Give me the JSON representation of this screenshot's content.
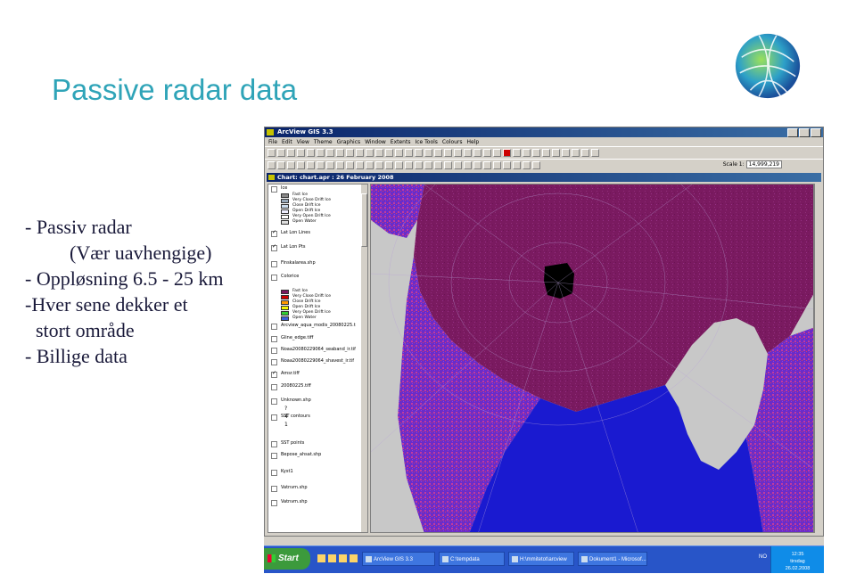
{
  "slide": {
    "title": "Passive radar data",
    "bullets": [
      "- Passiv radar",
      "(Vær uavhengige)",
      "- Oppløsning 6.5 - 25 km",
      "-Hver sene dekker et",
      "stort område",
      "- Billige data"
    ]
  },
  "app": {
    "title": "ArcView GIS 3.3",
    "menu": [
      "File",
      "Edit",
      "View",
      "Theme",
      "Graphics",
      "Window",
      "Extents",
      "Ice Tools",
      "Colours",
      "Help"
    ],
    "scale_label": "Scale 1:",
    "scale_value": "14,999,219",
    "view_title": "Chart: chart.apr : 26 February 2008"
  },
  "legend": {
    "layers": [
      {
        "name": "Ice",
        "checked": false
      },
      {
        "name": "Lat Lon Lines",
        "checked": true
      },
      {
        "name": "Lat Lon Pts",
        "checked": true
      },
      {
        "name": "Finskalarea.shp",
        "checked": false
      },
      {
        "name": "Colorice",
        "checked": false
      },
      {
        "name": "Arcview_aqua_modis_20080225.t",
        "checked": false
      },
      {
        "name": "Gline_edge.tiff",
        "checked": false
      },
      {
        "name": "Noaa20080229064_seaband_ir.tif",
        "checked": false
      },
      {
        "name": "Noaa20080229064_shavest_ir.tif",
        "checked": false
      },
      {
        "name": "Amsr.tiff",
        "checked": true
      },
      {
        "name": "20080225.tiff",
        "checked": false
      },
      {
        "name": "Unknown.shp",
        "checked": false
      },
      {
        "name": "SST contours",
        "checked": false
      },
      {
        "name": "SST points",
        "checked": false
      },
      {
        "name": "Bepose_ahsat.shp",
        "checked": false
      },
      {
        "name": "Kyst1",
        "checked": false
      },
      {
        "name": "Vatnvm.shp",
        "checked": false
      },
      {
        "name": "Vatnvm.shp",
        "checked": false
      }
    ],
    "ice_classes": [
      "Fast Ice",
      "Very Close Drift Ice",
      "Close Drift Ice",
      "Open Drift Ice",
      "Very Open Drift Ice",
      "Open Water"
    ],
    "colorice_classes": [
      "Fast Ice",
      "Very Close Drift Ice",
      "Close Drift Ice",
      "Open Drift Ice",
      "Very Open Drift Ice",
      "Open Water"
    ],
    "sst_labels": [
      "?",
      "4",
      "1"
    ]
  },
  "colors": {
    "title_teal": "#2fa4b8",
    "sea_ice": "#7a1a60",
    "ocean": "#1a1ad0",
    "land": "#c8c8c8",
    "title_bar": "#0a246a"
  },
  "taskbar": {
    "start": "Start",
    "tasks": [
      "ArcView GIS 3.3",
      "C:\\tempdata",
      "H:\\mmitetot\\arcview",
      "Dokument1 - Microsof..."
    ],
    "clock_time": "12:35",
    "clock_day": "tirsdag",
    "clock_date": "26.02.2008",
    "lang": "NO"
  }
}
